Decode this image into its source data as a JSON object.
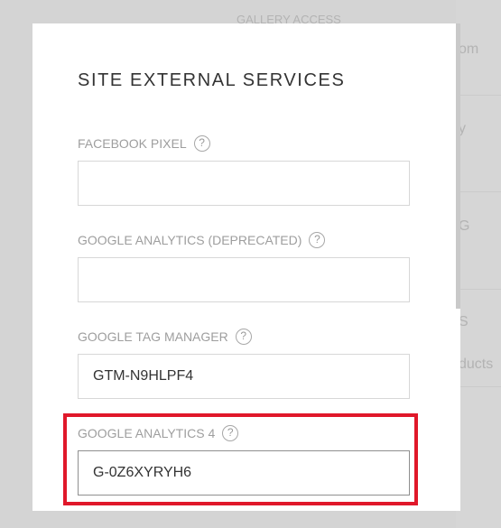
{
  "background": {
    "top_text": "GALLERY ACCESS",
    "items": [
      "om",
      "y",
      "G",
      "S",
      "ducts"
    ]
  },
  "modal": {
    "title": "SITE EXTERNAL SERVICES",
    "fields": [
      {
        "label": "FACEBOOK PIXEL",
        "value": ""
      },
      {
        "label": "GOOGLE ANALYTICS (DEPRECATED)",
        "value": ""
      },
      {
        "label": "GOOGLE TAG MANAGER",
        "value": "GTM-N9HLPF4"
      },
      {
        "label": "GOOGLE ANALYTICS 4",
        "value": "G-0Z6XYRYH6"
      }
    ],
    "help_glyph": "?"
  },
  "annotation": {
    "highlight_color": "#e0182a"
  }
}
